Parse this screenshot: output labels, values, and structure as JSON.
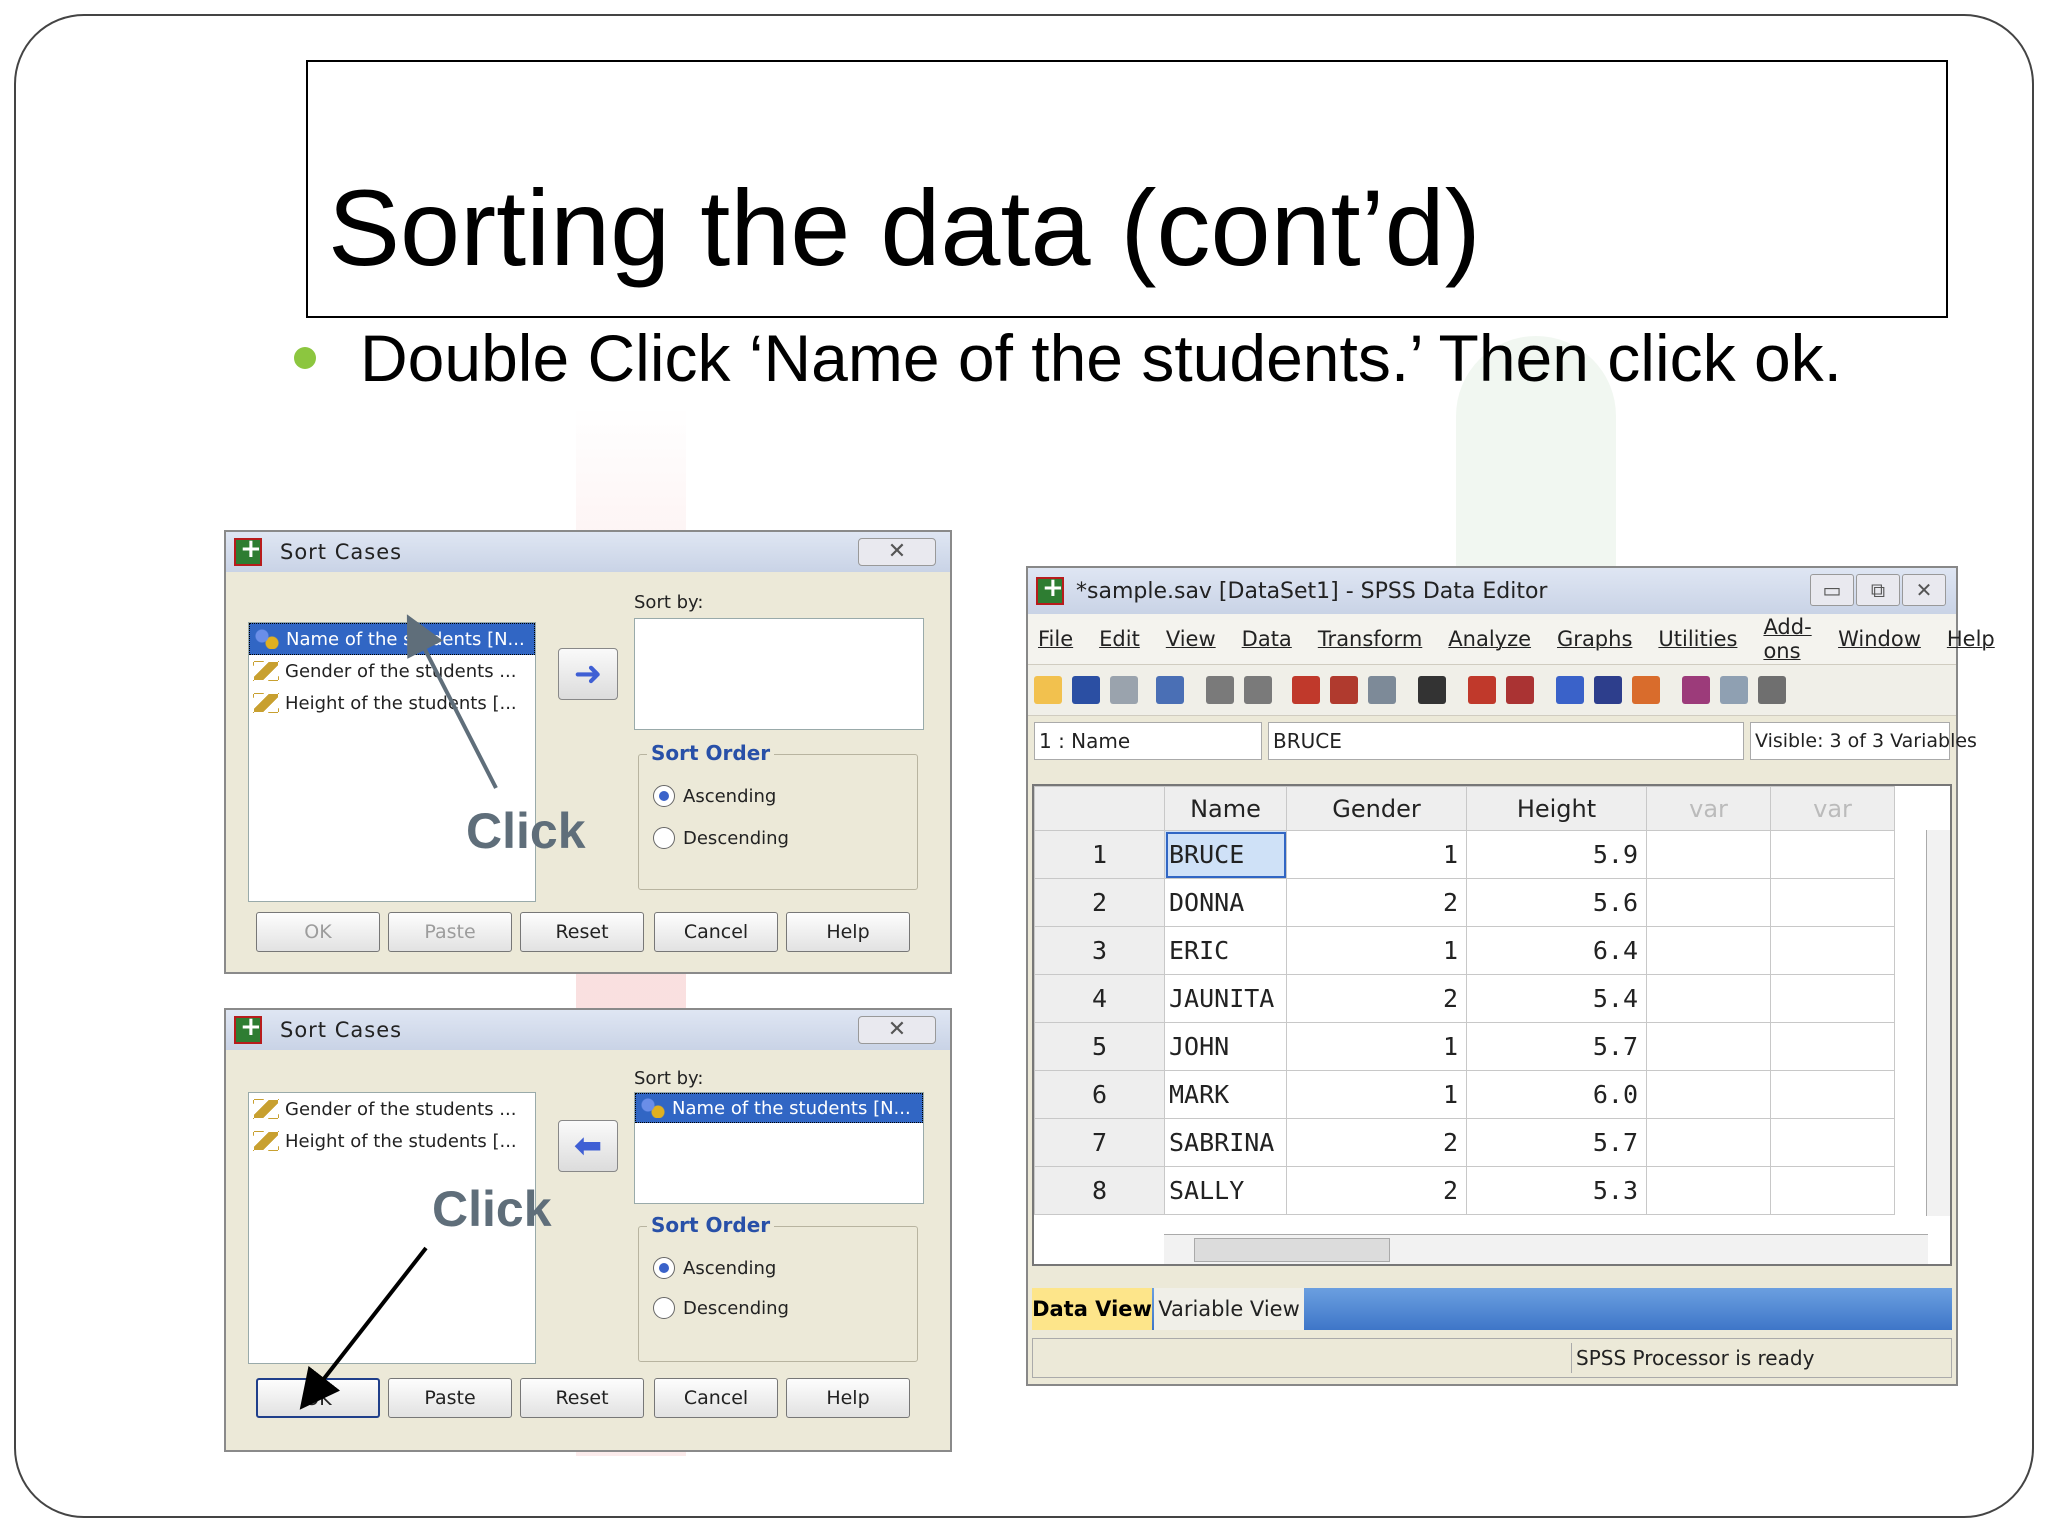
{
  "slide": {
    "title": "Sorting the data (cont’d)",
    "bullet": "Double Click ‘Name of the students.’ Then click ok."
  },
  "dialog1": {
    "title": "Sort Cases",
    "close": "✕",
    "variables": [
      {
        "label": "Name of the students [N...",
        "icon": "nominal-icon",
        "selected": true
      },
      {
        "label": "Gender of the students ...",
        "icon": "scale-icon",
        "selected": false
      },
      {
        "label": "Height of the students [...",
        "icon": "scale-icon",
        "selected": false
      }
    ],
    "move_arrow": "➜",
    "sort_by_label": "Sort by:",
    "sort_by_items": [],
    "sort_order_label": "Sort Order",
    "ascending": "Ascending",
    "descending": "Descending",
    "click_label": "Click",
    "buttons": {
      "ok": "OK",
      "paste": "Paste",
      "reset": "Reset",
      "cancel": "Cancel",
      "help": "Help"
    }
  },
  "dialog2": {
    "title": "Sort Cases",
    "close": "✕",
    "variables": [
      {
        "label": "Gender of the students ...",
        "icon": "scale-icon",
        "selected": false
      },
      {
        "label": "Height of the students [...",
        "icon": "scale-icon",
        "selected": false
      }
    ],
    "move_arrow": "⬅",
    "sort_by_label": "Sort by:",
    "sort_by_items": [
      "Name of the students [N..."
    ],
    "sort_order_label": "Sort Order",
    "ascending": "Ascending",
    "descending": "Descending",
    "click_label": "Click",
    "buttons": {
      "ok": "OK",
      "paste": "Paste",
      "reset": "Reset",
      "cancel": "Cancel",
      "help": "Help"
    }
  },
  "editor": {
    "title": "*sample.sav [DataSet1] - SPSS Data Editor",
    "win_buttons": [
      "▭",
      "⧉",
      "✕"
    ],
    "menu": [
      "File",
      "Edit",
      "View",
      "Data",
      "Transform",
      "Analyze",
      "Graphs",
      "Utilities",
      "Add-ons",
      "Window",
      "Help"
    ],
    "cell_ref": "1 : Name",
    "cell_value": "BRUCE",
    "visible": "Visible: 3 of 3 Variables",
    "columns": [
      "Name",
      "Gender",
      "Height",
      "var",
      "var"
    ],
    "rows": [
      {
        "n": "1",
        "name": "BRUCE",
        "gender": "1",
        "height": "5.9"
      },
      {
        "n": "2",
        "name": "DONNA",
        "gender": "2",
        "height": "5.6"
      },
      {
        "n": "3",
        "name": "ERIC",
        "gender": "1",
        "height": "6.4"
      },
      {
        "n": "4",
        "name": "JAUNITA",
        "gender": "2",
        "height": "5.4"
      },
      {
        "n": "5",
        "name": "JOHN",
        "gender": "1",
        "height": "5.7"
      },
      {
        "n": "6",
        "name": "MARK",
        "gender": "1",
        "height": "6.0"
      },
      {
        "n": "7",
        "name": "SABRINA",
        "gender": "2",
        "height": "5.7"
      },
      {
        "n": "8",
        "name": "SALLY",
        "gender": "2",
        "height": "5.3"
      }
    ],
    "tab_data_view": "Data View",
    "tab_variable_view": "Variable View",
    "status": "SPSS  Processor is ready"
  },
  "colors": {
    "bullet": "#8cc63f",
    "selection": "#3166c4",
    "sort_order": "#2850a8",
    "active_tab": "#fde58a"
  }
}
